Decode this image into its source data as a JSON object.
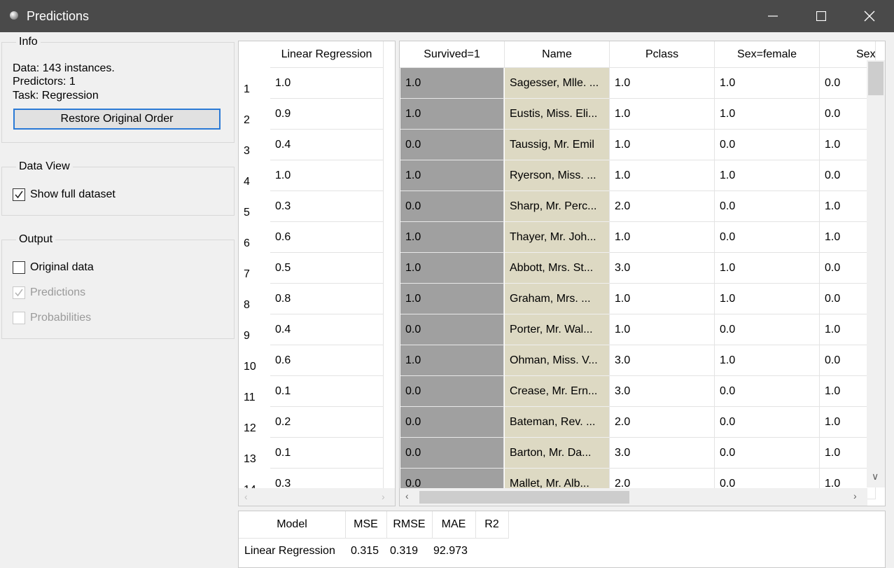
{
  "window": {
    "title": "Predictions"
  },
  "info": {
    "title": "Info",
    "data": "Data: 143 instances.",
    "predictors": "Predictors: 1",
    "task": "Task: Regression",
    "restore_button": "Restore Original Order"
  },
  "data_view": {
    "title": "Data View",
    "show_full": {
      "label": "Show full dataset",
      "checked": true
    }
  },
  "output": {
    "title": "Output",
    "original": {
      "label": "Original data",
      "checked": false
    },
    "predictions": {
      "label": "Predictions",
      "checked": true,
      "disabled": true
    },
    "probabilities": {
      "label": "Probabilities",
      "checked": false,
      "disabled": true
    }
  },
  "predictions_table": {
    "header": "Linear Regression",
    "rows": [
      "1.0",
      "0.9",
      "0.4",
      "1.0",
      "0.3",
      "0.6",
      "0.5",
      "0.8",
      "0.4",
      "0.6",
      "0.1",
      "0.2",
      "0.1",
      "0.3"
    ]
  },
  "data_table": {
    "headers": [
      "Survived=1",
      "Name",
      "Pclass",
      "Sex=female",
      "Sex="
    ],
    "rows": [
      [
        "1.0",
        "Sagesser, Mlle. ...",
        "1.0",
        "1.0",
        "0.0"
      ],
      [
        "1.0",
        "Eustis, Miss. Eli...",
        "1.0",
        "1.0",
        "0.0"
      ],
      [
        "0.0",
        "Taussig, Mr. Emil",
        "1.0",
        "0.0",
        "1.0"
      ],
      [
        "1.0",
        "Ryerson, Miss. ...",
        "1.0",
        "1.0",
        "0.0"
      ],
      [
        "0.0",
        "Sharp, Mr. Perc...",
        "2.0",
        "0.0",
        "1.0"
      ],
      [
        "1.0",
        "Thayer, Mr. Joh...",
        "1.0",
        "0.0",
        "1.0"
      ],
      [
        "1.0",
        "Abbott, Mrs. St...",
        "3.0",
        "1.0",
        "0.0"
      ],
      [
        "1.0",
        "Graham, Mrs. ...",
        "1.0",
        "1.0",
        "0.0"
      ],
      [
        "0.0",
        "Porter, Mr. Wal...",
        "1.0",
        "0.0",
        "1.0"
      ],
      [
        "1.0",
        "Ohman, Miss. V...",
        "3.0",
        "1.0",
        "0.0"
      ],
      [
        "0.0",
        "Crease, Mr. Ern...",
        "3.0",
        "0.0",
        "1.0"
      ],
      [
        "0.0",
        "Bateman, Rev. ...",
        "2.0",
        "0.0",
        "1.0"
      ],
      [
        "0.0",
        "Barton, Mr. Da...",
        "3.0",
        "0.0",
        "1.0"
      ],
      [
        "0.0",
        "Mallet, Mr. Alb...",
        "2.0",
        "0.0",
        "1.0"
      ]
    ]
  },
  "performance": {
    "headers": [
      "Model",
      "MSE",
      "RMSE",
      "MAE",
      "R2"
    ],
    "rows": [
      [
        "Linear Regression",
        "0.315",
        "0.319",
        "92.973",
        ""
      ]
    ]
  },
  "colors": {
    "title_bar": "#4a4a4a",
    "target_column": "#a0a0a0",
    "meta_column": "#ddd9c3",
    "focus": "#2b7ad6"
  }
}
